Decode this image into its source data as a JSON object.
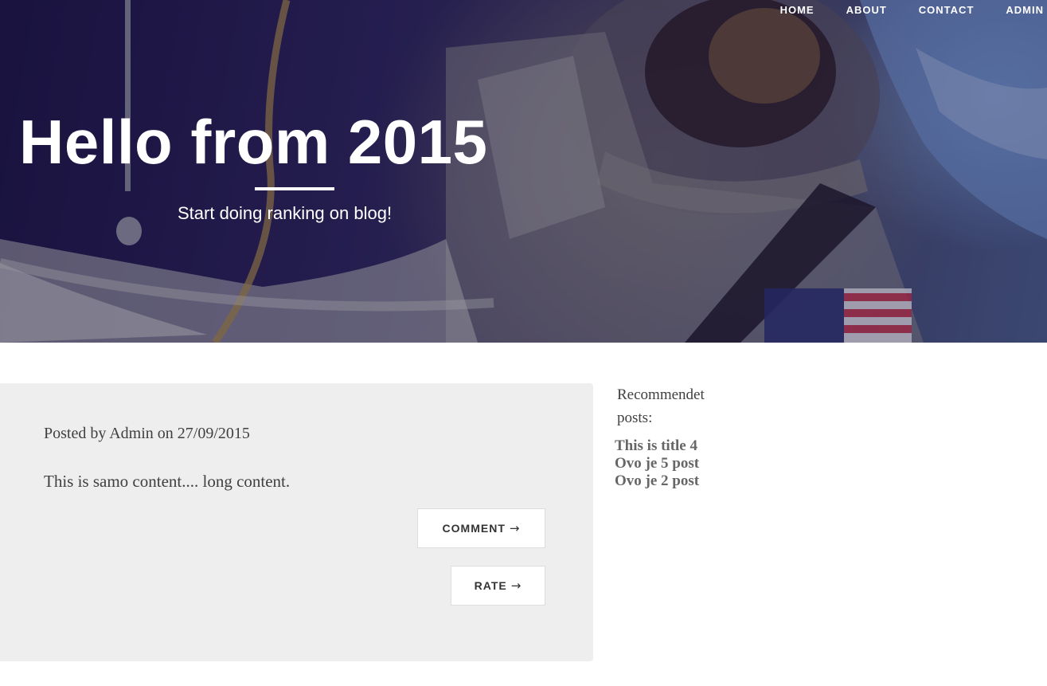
{
  "nav": {
    "items": [
      {
        "label": "HOME"
      },
      {
        "label": "ABOUT"
      },
      {
        "label": "CONTACT"
      },
      {
        "label": "ADMIN"
      }
    ]
  },
  "hero": {
    "title": "Hello from 2015",
    "subtitle": "Start doing ranking on blog!",
    "background_image": "astronaut-in-space-photo"
  },
  "post": {
    "meta": "Posted by Admin on 27/09/2015",
    "content": "This is samo content.... long content.",
    "comment_label": "COMMENT",
    "rate_label": "RATE",
    "arrow": "→"
  },
  "sidebar": {
    "heading": "Recommendet posts:",
    "links": [
      {
        "label": "This is title 4"
      },
      {
        "label": "Ovo je 5 post"
      },
      {
        "label": "Ovo je 2 post"
      }
    ]
  },
  "colors": {
    "card_bg": "#eeeeee",
    "body_text": "#404040",
    "link_text": "#666666",
    "hero_text": "#ffffff"
  }
}
